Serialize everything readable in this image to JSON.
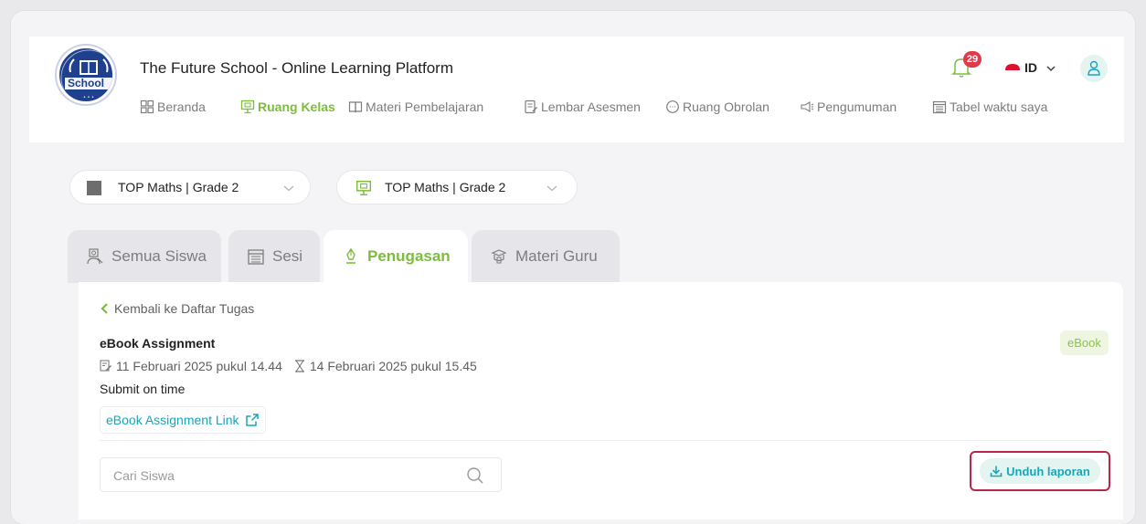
{
  "header": {
    "logo_text": "School",
    "app_title": "The Future School - Online Learning Platform",
    "notification_count": "29",
    "language": "ID"
  },
  "nav": {
    "items": [
      {
        "label": "Beranda",
        "icon": "grid-icon"
      },
      {
        "label": "Ruang Kelas",
        "icon": "classroom-icon",
        "active": true
      },
      {
        "label": "Materi Pembelajaran",
        "icon": "book-icon"
      },
      {
        "label": "Lembar Asesmen",
        "icon": "assessment-icon"
      },
      {
        "label": "Ruang Obrolan",
        "icon": "chat-icon"
      },
      {
        "label": "Pengumuman",
        "icon": "megaphone-icon"
      },
      {
        "label": "Tabel waktu saya",
        "icon": "calendar-icon"
      }
    ]
  },
  "selectors": {
    "course": "TOP Maths | Grade 2",
    "class": "TOP Maths | Grade 2"
  },
  "tabs": [
    {
      "label": "Semua Siswa",
      "icon": "students-icon"
    },
    {
      "label": "Sesi",
      "icon": "calendar-icon"
    },
    {
      "label": "Penugasan",
      "icon": "pen-icon",
      "active": true
    },
    {
      "label": "Materi Guru",
      "icon": "materials-icon"
    }
  ],
  "assignment": {
    "back_label": "Kembali ke Daftar Tugas",
    "title": "eBook Assignment",
    "type_tag": "eBook",
    "start_date": "11 Februari 2025 pukul 14.44",
    "due_date": "14 Februari 2025 pukul 15.45",
    "note": "Submit on time",
    "link_label": "eBook Assignment Link"
  },
  "search": {
    "placeholder": "Cari Siswa"
  },
  "actions": {
    "download_label": "Unduh laporan"
  },
  "colors": {
    "accent_green": "#7cbd3c",
    "accent_teal": "#19a6b8",
    "badge_red": "#e03a4a",
    "highlight": "#b8264a"
  }
}
